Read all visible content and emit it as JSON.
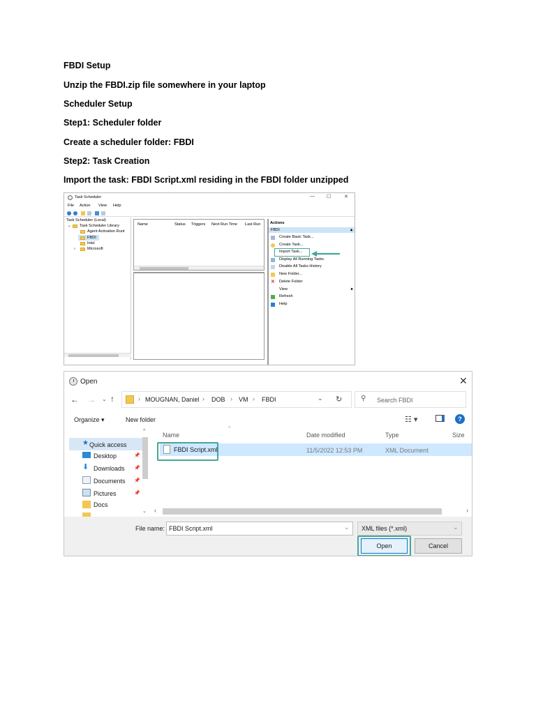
{
  "document": {
    "lines": [
      "FBDI Setup",
      "Unzip the FBDI.zip file somewhere in your laptop",
      "Scheduler Setup",
      "Step1: Scheduler folder",
      "Create a scheduler folder: FBDI",
      "Step2: Task Creation",
      "Import the task: FBDI Script.xml residing in the FBDI folder unzipped"
    ]
  },
  "task_scheduler": {
    "title": "Task Scheduler",
    "window_controls": [
      "—",
      "☐",
      "✕"
    ],
    "menu": [
      "File",
      "Action",
      "View",
      "Help"
    ],
    "tree": [
      "Task Scheduler (Local)",
      "Task Scheduler Library",
      "Agent Activation Runt",
      "FBDI",
      "Intel",
      "Microsoft"
    ],
    "columns": [
      "Name",
      "Status",
      "Triggers",
      "Next Run Time",
      "Last Run"
    ],
    "actions_header": "Actions",
    "actions_sub": "FBDI",
    "actions": [
      "Create Basic Task...",
      "Create Task...",
      "Import Task...",
      "Display All Running Tasks",
      "Disable All Tasks History",
      "New Folder...",
      "Delete Folder",
      "View",
      "Refresh",
      "Help"
    ],
    "highlight_color": "#43a89a"
  },
  "open_dialog": {
    "title": "Open",
    "breadcrumb": [
      "MOUGNAN, Daniel",
      "DOB",
      "VM",
      "FBDI"
    ],
    "search_placeholder": "Search FBDI",
    "toolbar": {
      "organize": "Organize ▾",
      "new_folder": "New folder"
    },
    "columns": [
      "Name",
      "Date modified",
      "Type",
      "Size"
    ],
    "nav": [
      "Quick access",
      "Desktop",
      "Downloads",
      "Documents",
      "Pictures",
      "Docs"
    ],
    "file": {
      "name": "FBDI Script.xml",
      "date": "11/5/2022 12:53 PM",
      "type": "XML Document"
    },
    "file_name_label": "File name:",
    "file_name_value": "FBDI Script.xml",
    "file_type": "XML files (*.xml)",
    "open_button": "Open",
    "cancel_button": "Cancel",
    "accent": "#0078d7"
  }
}
